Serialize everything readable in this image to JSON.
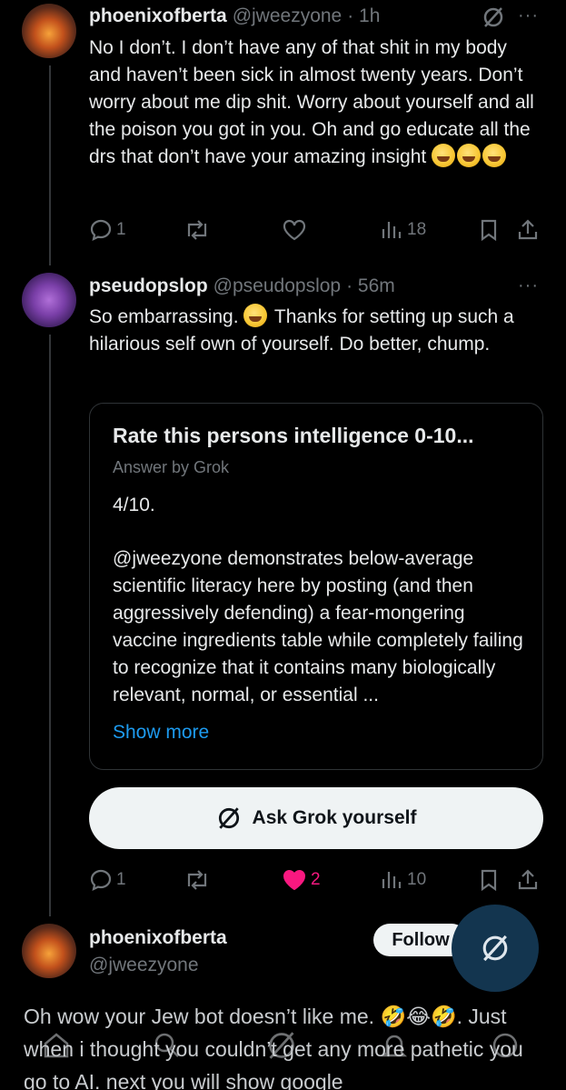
{
  "tweet1": {
    "display_name": "phoenixofberta",
    "handle": "@jweezyone",
    "time": "· 1h",
    "text": "No I don’t. I don’t have any of that shit in my body and haven’t been sick in almost twenty years. Don’t worry about me dip shit. Worry about yourself and all the poison you got in you. Oh and go educate all the drs that don’t have your amazing insight",
    "emojis": [
      "joy",
      "rofl",
      "joy"
    ],
    "actions": {
      "replies": "1",
      "reposts": "",
      "likes": "",
      "views": "18"
    }
  },
  "tweet2": {
    "display_name": "pseudopslop",
    "handle": "@pseudopslop",
    "time": "· 56m",
    "text_a": "So embarrassing.",
    "text_b": "Thanks for setting up such a hilarious self own of yourself. Do better, chump.",
    "card": {
      "title": "Rate this persons intelligence 0-10...",
      "subtitle": "Answer by Grok",
      "score": "4/10.",
      "body": "@jweezyone demonstrates below-average scientific literacy here by posting (and then aggressively defending) a fear-mongering vaccine ingredients table while completely failing to recognize that it contains many biologically relevant, normal, or essential ...",
      "show_more": "Show more"
    },
    "grok_button": "Ask Grok yourself",
    "actions": {
      "replies": "1",
      "reposts": "",
      "likes": "2",
      "views": "10"
    },
    "like_color": "#f91880"
  },
  "tweet3": {
    "display_name": "phoenixofberta",
    "handle": "@jweezyone",
    "follow_label": "Follow",
    "text": "Oh wow your Jew bot doesn’t like me. 🤣😂🤣. Just when i thought you couldn’t get any more pathetic you go to AI. next you will show google"
  },
  "more_glyph": "···",
  "colors": {
    "accent": "#1d9bf0",
    "muted": "#71767b",
    "fab": "#13354f"
  }
}
